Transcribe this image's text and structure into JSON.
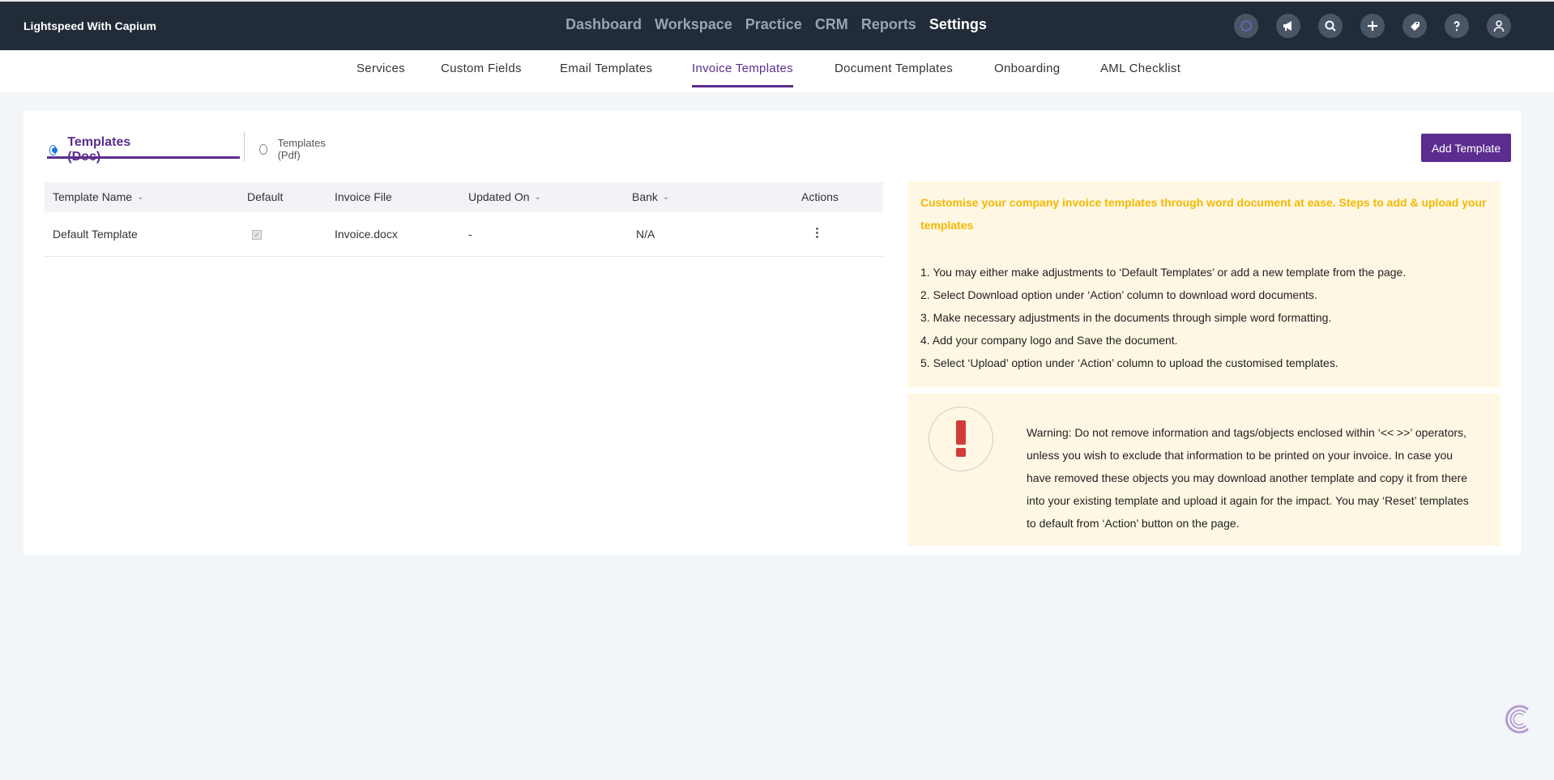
{
  "app": {
    "brand": "Lightspeed With Capium"
  },
  "mainnav": {
    "items": [
      "Dashboard",
      "Workspace",
      "Practice",
      "CRM",
      "Reports",
      "Settings"
    ],
    "active": "Settings"
  },
  "subnav": {
    "items": [
      "Services",
      "Custom Fields",
      "Email Templates",
      "Invoice Templates",
      "Document Templates",
      "Onboarding",
      "AML Checklist"
    ],
    "active": "Invoice Templates"
  },
  "doc_tabs": {
    "doc": "Templates (Doc)",
    "pdf": "Templates (Pdf)",
    "selected": "doc"
  },
  "add_button": "Add Template",
  "table": {
    "columns": [
      "Template Name",
      "Default",
      "Invoice File",
      "Updated On",
      "Bank",
      "Actions"
    ],
    "rows": [
      {
        "name": "Default Template",
        "default": true,
        "file": "Invoice.docx",
        "updated": "-",
        "bank": "N/A"
      }
    ]
  },
  "info": {
    "title": "Customise your company invoice templates through word document at ease. Steps to add & upload your templates",
    "steps": [
      "1. You may either make adjustments to ‘Default Templates’ or add a new template from the page.",
      "2. Select Download option under ‘Action’ column to download word documents.",
      "3. Make necessary adjustments in the documents through simple word formatting.",
      "4. Add your company logo and Save the document.",
      "5. Select ‘Upload’ option under ‘Action’ column to upload the customised templates."
    ]
  },
  "warning": {
    "text": "Warning: Do not remove information and tags/objects enclosed within ‘<< >>’ operators, unless you wish to exclude that information to be printed on your invoice. In case you have removed these objects you may download another template and copy it from there into your existing template and upload it again for the impact. You may ‘Reset’ templates to default from ‘Action’ button on the page."
  },
  "colors": {
    "accent": "#5b2d8e",
    "topbar": "#222b38",
    "info_bg": "#fef7e3",
    "info_title": "#f5b800",
    "warn_icon": "#d33b3b"
  },
  "icons": [
    "capium-logo-icon",
    "megaphone-icon",
    "search-icon",
    "plus-icon",
    "tag-icon",
    "help-icon",
    "user-icon"
  ]
}
